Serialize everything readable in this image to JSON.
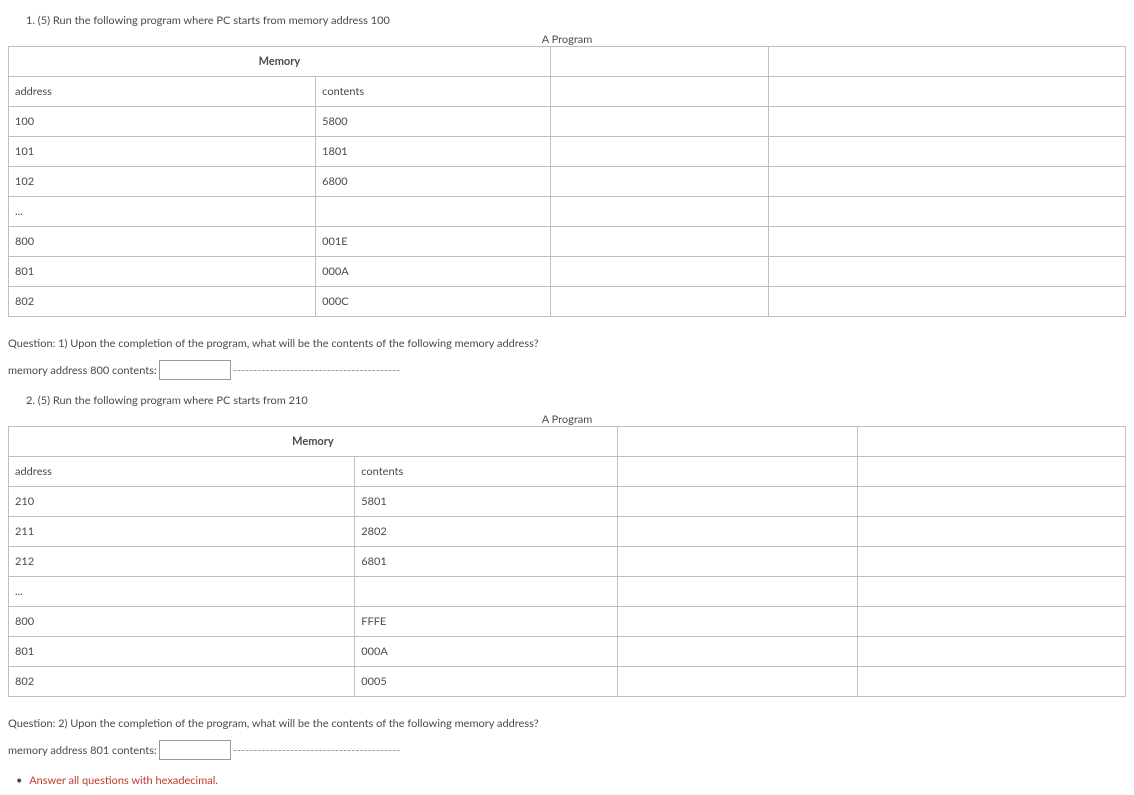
{
  "q1": {
    "prompt": "1. (5) Run the following program where PC starts from memory address 100",
    "caption": "A Program",
    "mem_header": "Memory",
    "col_addr": "address",
    "col_cont": "contents",
    "rows": [
      {
        "a": "100",
        "c": "5800"
      },
      {
        "a": "101",
        "c": "1801"
      },
      {
        "a": "102",
        "c": "6800"
      },
      {
        "a": "...",
        "c": ""
      },
      {
        "a": "800",
        "c": "001E"
      },
      {
        "a": "801",
        "c": "000A"
      },
      {
        "a": "802",
        "c": "000C"
      }
    ],
    "question": "Question: 1) Upon the completion of the program, what will be the contents of the following memory address?",
    "answer_label": "memory address 800 contents: ",
    "dashes": " -----------------------------------------"
  },
  "q2": {
    "prompt": "2. (5) Run the following program where PC starts from 210",
    "caption": "A Program",
    "mem_header": "Memory",
    "col_addr": "address",
    "col_cont": "contents",
    "rows": [
      {
        "a": "210",
        "c": "5801"
      },
      {
        "a": "211",
        "c": "2802"
      },
      {
        "a": "212",
        "c": "6801"
      },
      {
        "a": "...",
        "c": ""
      },
      {
        "a": "800",
        "c": "FFFE"
      },
      {
        "a": "801",
        "c": "000A"
      },
      {
        "a": "802",
        "c": "0005"
      }
    ],
    "question": "Question: 2) Upon the completion of the program, what will be the contents of the following memory address?",
    "answer_label": "memory address 801 contents: ",
    "dashes": " -----------------------------------------"
  },
  "footer_note": "Answer all questions with hexadecimal."
}
